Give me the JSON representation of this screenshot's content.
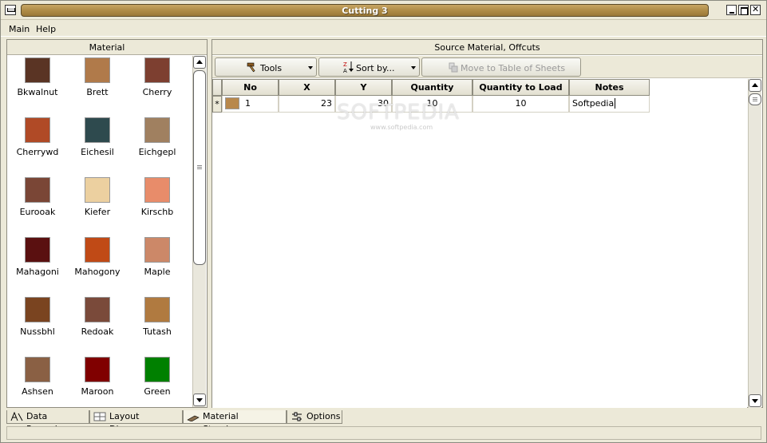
{
  "window": {
    "title": "Cutting 3"
  },
  "menu": [
    "Main",
    "Help"
  ],
  "left_panel": {
    "header": "Material",
    "materials": [
      {
        "name": "Bkwalnut",
        "color": "#5a3424"
      },
      {
        "name": "Brett",
        "color": "#b07a4a"
      },
      {
        "name": "Cherry",
        "color": "#7d3f30"
      },
      {
        "name": "Cherrywd",
        "color": "#b04a26"
      },
      {
        "name": "Eichesil",
        "color": "#2e4a4e"
      },
      {
        "name": "Eichgepl",
        "color": "#a08060"
      },
      {
        "name": "Eurooak",
        "color": "#7a4636"
      },
      {
        "name": "Kiefer",
        "color": "#ecd0a0"
      },
      {
        "name": "Kirschb",
        "color": "#e88c6a"
      },
      {
        "name": "Mahagoni",
        "color": "#5a1010"
      },
      {
        "name": "Mahogony",
        "color": "#c04a16"
      },
      {
        "name": "Maple",
        "color": "#cc8868"
      },
      {
        "name": "Nussbhl",
        "color": "#7a4420"
      },
      {
        "name": "Redoak",
        "color": "#7a4a3a"
      },
      {
        "name": "Tutash",
        "color": "#b07a40"
      },
      {
        "name": "Ashsen",
        "color": "#8a6044"
      },
      {
        "name": "Maroon",
        "color": "#800000"
      },
      {
        "name": "Green",
        "color": "#008000"
      }
    ]
  },
  "right_panel": {
    "header": "Source Material, Offcuts",
    "toolbar": {
      "tools": "Tools",
      "sort": "Sort by...",
      "move": "Move to Table of Sheets"
    },
    "watermark": "SOFTPEDIA",
    "watermark_url": "www.softpedia.com",
    "columns": [
      "No",
      "X",
      "Y",
      "Quantity",
      "Quantity to Load",
      "Notes"
    ],
    "rows": [
      {
        "marker": "*",
        "swatch": "#b8884c",
        "no": "1",
        "x": "23",
        "y": "30",
        "quantity": "10",
        "quantity_to_load": "10",
        "notes": "Softpedia"
      }
    ]
  },
  "tabs": [
    "Data Preparing",
    "Layout Diagrams",
    "Material Storehouse",
    "Options"
  ],
  "active_tab": "Material Storehouse"
}
